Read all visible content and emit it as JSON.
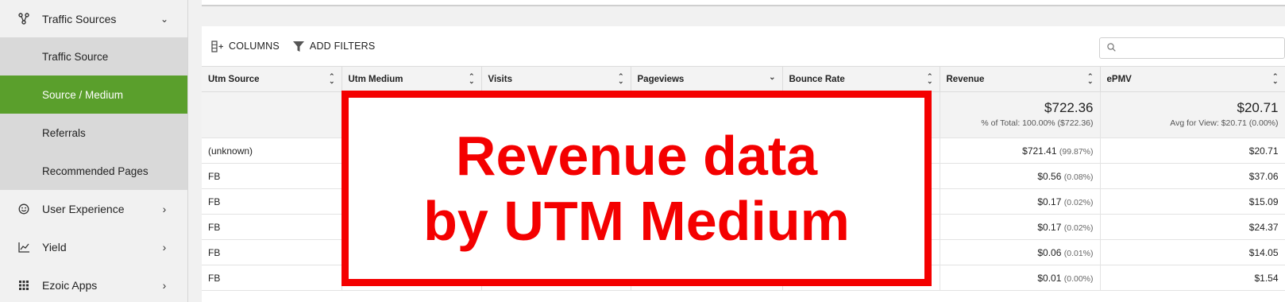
{
  "sidebar": {
    "section": {
      "label": "Traffic Sources",
      "icon": "share-nodes-icon"
    },
    "sub_items": [
      {
        "label": "Traffic Source",
        "active": false
      },
      {
        "label": "Source / Medium",
        "active": true
      },
      {
        "label": "Referrals",
        "active": false
      },
      {
        "label": "Recommended Pages",
        "active": false
      }
    ],
    "items": [
      {
        "label": "User Experience",
        "icon": "smiley-icon"
      },
      {
        "label": "Yield",
        "icon": "line-chart-icon"
      },
      {
        "label": "Ezoic Apps",
        "icon": "grid-icon"
      }
    ]
  },
  "toolbar": {
    "columns_label": "COLUMNS",
    "filters_label": "ADD FILTERS",
    "search_placeholder": ""
  },
  "table": {
    "headers": [
      "Utm Source",
      "Utm Medium",
      "Visits",
      "Pageviews",
      "Bounce Rate",
      "Revenue",
      "ePMV"
    ],
    "summary": {
      "revenue": {
        "value": "$722.36",
        "sub": "% of Total: 100.00% ($722.36)"
      },
      "epmv": {
        "value": "$20.71",
        "sub": "Avg for View: $20.71 (0.00%)"
      }
    },
    "rows": [
      {
        "source": "(unknown)",
        "revenue": "$721.41",
        "revenue_pct": "(99.87%)",
        "epmv": "$20.71"
      },
      {
        "source": "FB",
        "revenue": "$0.56",
        "revenue_pct": "(0.08%)",
        "epmv": "$37.06"
      },
      {
        "source": "FB",
        "revenue": "$0.17",
        "revenue_pct": "(0.02%)",
        "epmv": "$15.09"
      },
      {
        "source": "FB",
        "revenue": "$0.17",
        "revenue_pct": "(0.02%)",
        "epmv": "$24.37"
      },
      {
        "source": "FB",
        "revenue": "$0.06",
        "revenue_pct": "(0.01%)",
        "epmv": "$14.05"
      },
      {
        "source": "FB",
        "revenue": "$0.01",
        "revenue_pct": "(0.00%)",
        "epmv": "$1.54"
      }
    ]
  },
  "overlay": {
    "line1": "Revenue data",
    "line2": "by UTM Medium",
    "color": "#f40000"
  },
  "colors": {
    "active_green": "#5a9f2c",
    "sidebar_sub_bg": "#d9d9d9"
  }
}
